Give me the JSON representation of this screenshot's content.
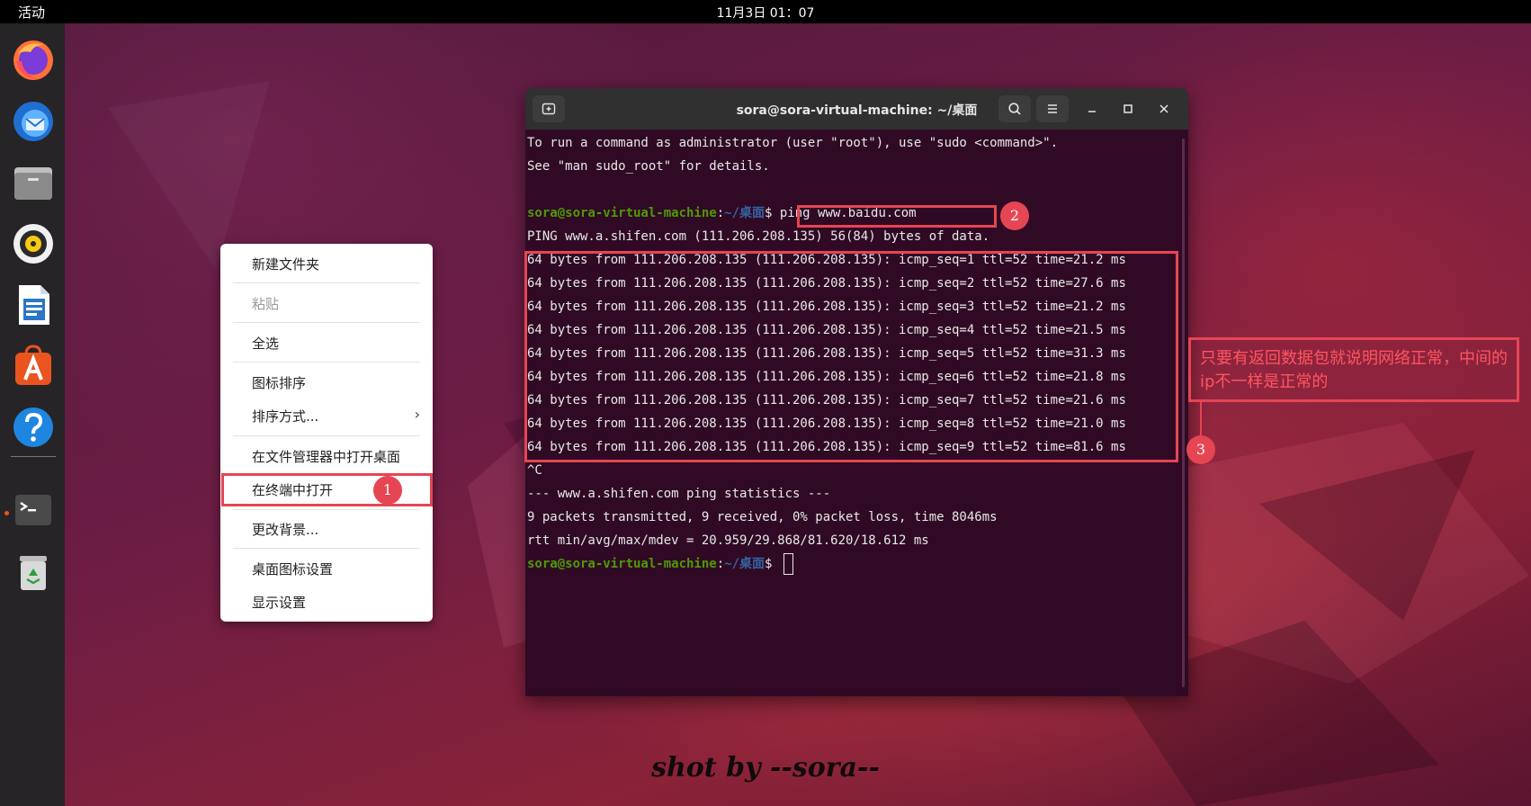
{
  "topbar": {
    "activities_label": "活动",
    "clock": "11月3日 01：07"
  },
  "dock": {
    "items": [
      {
        "name": "firefox"
      },
      {
        "name": "thunderbird"
      },
      {
        "name": "files"
      },
      {
        "name": "rhythmbox"
      },
      {
        "name": "libreoffice-writer"
      },
      {
        "name": "app-center"
      },
      {
        "name": "help"
      },
      {
        "name": "terminal",
        "running": true
      },
      {
        "name": "trash"
      }
    ]
  },
  "context_menu": {
    "items": [
      {
        "label": "新建文件夹",
        "enabled": true
      },
      {
        "label": "粘贴",
        "enabled": false
      },
      {
        "label": "全选",
        "enabled": true
      },
      {
        "label": "图标排序",
        "enabled": true
      },
      {
        "label": "排序方式...",
        "enabled": true,
        "submenu": "›"
      },
      {
        "label": "在文件管理器中打开桌面",
        "enabled": true
      },
      {
        "label": "在终端中打开",
        "enabled": true
      },
      {
        "label": "更改背景...",
        "enabled": true
      },
      {
        "label": "桌面图标设置",
        "enabled": true
      },
      {
        "label": "显示设置",
        "enabled": true
      }
    ]
  },
  "terminal": {
    "title": "sora@sora-virtual-machine: ~/桌面",
    "prompt_user": "sora@sora-virtual-machine",
    "prompt_sep": ":",
    "prompt_path": "~/桌面",
    "prompt_dollar": "$ ",
    "command": "ping www.baidu.com",
    "intro": [
      "To run a command as administrator (user \"root\"), use \"sudo <command>\".",
      "See \"man sudo_root\" for details."
    ],
    "ping_header": "PING www.a.shifen.com (111.206.208.135) 56(84) bytes of data.",
    "replies": [
      "64 bytes from 111.206.208.135 (111.206.208.135): icmp_seq=1 ttl=52 time=21.2 ms",
      "64 bytes from 111.206.208.135 (111.206.208.135): icmp_seq=2 ttl=52 time=27.6 ms",
      "64 bytes from 111.206.208.135 (111.206.208.135): icmp_seq=3 ttl=52 time=21.2 ms",
      "64 bytes from 111.206.208.135 (111.206.208.135): icmp_seq=4 ttl=52 time=21.5 ms",
      "64 bytes from 111.206.208.135 (111.206.208.135): icmp_seq=5 ttl=52 time=31.3 ms",
      "64 bytes from 111.206.208.135 (111.206.208.135): icmp_seq=6 ttl=52 time=21.8 ms",
      "64 bytes from 111.206.208.135 (111.206.208.135): icmp_seq=7 ttl=52 time=21.6 ms",
      "64 bytes from 111.206.208.135 (111.206.208.135): icmp_seq=8 ttl=52 time=21.0 ms",
      "64 bytes from 111.206.208.135 (111.206.208.135): icmp_seq=9 ttl=52 time=81.6 ms"
    ],
    "interrupt": "^C",
    "stats": [
      "--- www.a.shifen.com ping statistics ---",
      "9 packets transmitted, 9 received, 0% packet loss, time 8046ms",
      "rtt min/avg/max/mdev = 20.959/29.868/81.620/18.612 ms"
    ]
  },
  "annotations": {
    "badge1": "1",
    "badge2": "2",
    "badge3": "3",
    "note": "只要有返回数据包就说明网络正常，中间的ip不一样是正常的",
    "color": "#e64553"
  },
  "watermark": "shot by --sora--",
  "colors": {
    "terminal_bg": "#300a24",
    "prompt_user": "#4e9a06",
    "prompt_path": "#3465a4",
    "ubuntu_orange": "#e95420"
  }
}
